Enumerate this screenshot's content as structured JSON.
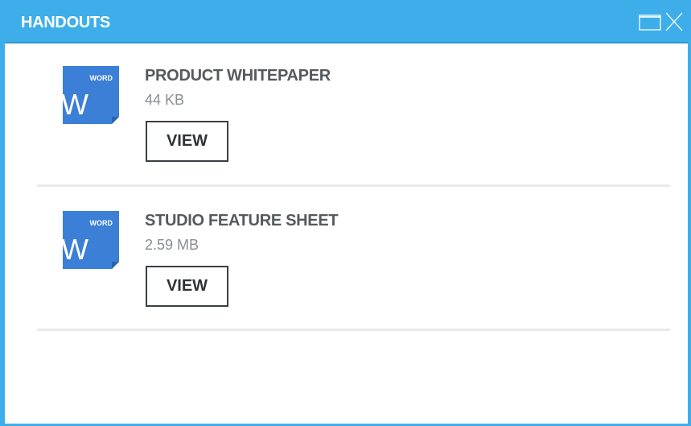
{
  "panel": {
    "title": "HANDOUTS",
    "accent_color": "#3daee9",
    "controls": {
      "maximize_icon": "maximize-icon",
      "close_icon": "close-icon"
    }
  },
  "handouts": [
    {
      "name": "PRODUCT WHITEPAPER",
      "size": "44 KB",
      "icon": "word-document-icon",
      "icon_label": "WORD",
      "icon_letter": "W",
      "action_label": "VIEW"
    },
    {
      "name": "STUDIO FEATURE SHEET",
      "size": "2.59 MB",
      "icon": "word-document-icon",
      "icon_label": "WORD",
      "icon_letter": "W",
      "action_label": "VIEW"
    }
  ]
}
